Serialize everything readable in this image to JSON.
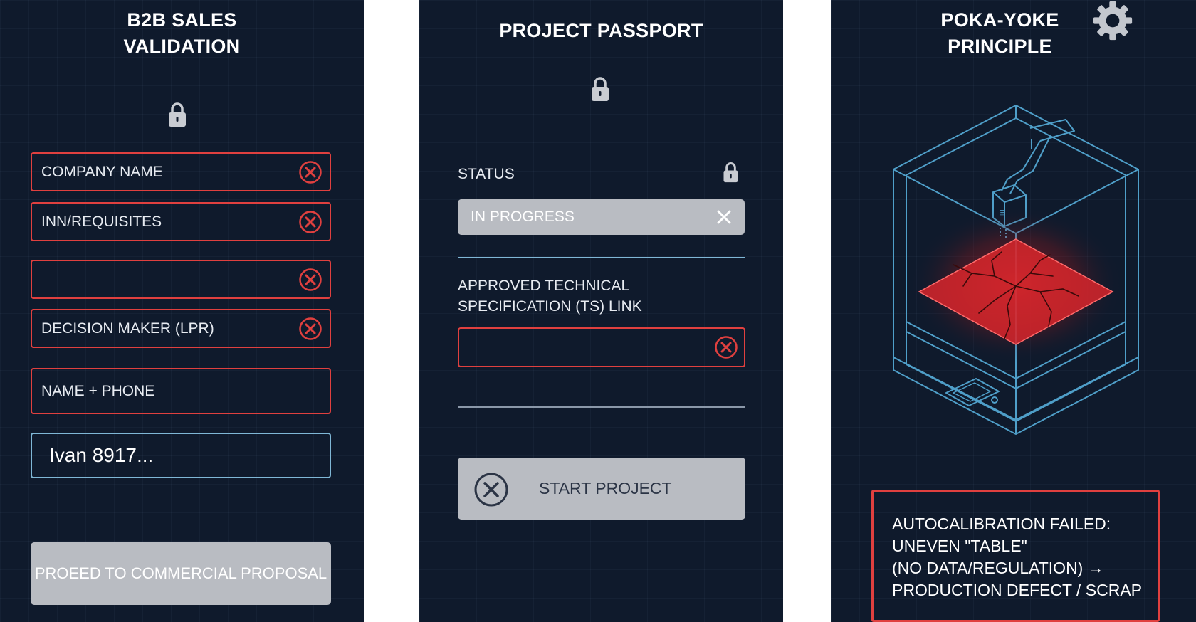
{
  "panels": [
    {
      "title_lines": [
        "B2B SALES",
        "VALIDATION"
      ],
      "fields": [
        {
          "label": "COMPANY NAME",
          "state": "error"
        },
        {
          "label": "INN/REQUISITES",
          "state": "error"
        },
        {
          "label": "",
          "state": "error"
        },
        {
          "label": "DECISION MAKER (LPR)",
          "state": "error"
        },
        {
          "label": "NAME + PHONE",
          "state": "error-no-icon"
        },
        {
          "label": "Ivan 8917...",
          "state": "filled"
        }
      ],
      "button": {
        "label": "PROEED TO COMMERCIAL PROPOSAL",
        "state": "disabled"
      },
      "icons": [
        "lock-icon",
        "close-circle-icon"
      ],
      "colors": {
        "error": "#e0403f",
        "filled_border": "#7fb7d6",
        "disabled_button": "#b9bcc2"
      }
    },
    {
      "title": "PROJECT PASSPORT",
      "status": {
        "label": "STATUS",
        "value": "IN PROGRESS",
        "locked": true
      },
      "ts_link": {
        "label_lines": [
          "APPROVED TECHNICAL",
          "SPECIFICATION (TS) LINK"
        ],
        "value": "",
        "state": "error"
      },
      "button": {
        "label": "START PROJECT",
        "state": "disabled"
      },
      "icons": [
        "lock-icon",
        "close-x-icon",
        "close-circle-icon"
      ]
    },
    {
      "title_lines": [
        "POKA-YOKE",
        "PRINCIPLE"
      ],
      "illustration": "3d-printer-cracked-bed-illustration",
      "alert_lines": [
        "AUTOCALIBRATION FAILED:",
        "UNEVEN \"TABLE\"",
        "(NO DATA/REGULATION) →",
        "PRODUCTION DEFECT / SCRAP"
      ],
      "icons": [
        "gear-icon"
      ]
    }
  ],
  "colors": {
    "panel_bg": "#0f1a2c",
    "divider": "#7fb7d6",
    "alert": "#e0403f",
    "printer_lines": "#4f9fc9"
  }
}
